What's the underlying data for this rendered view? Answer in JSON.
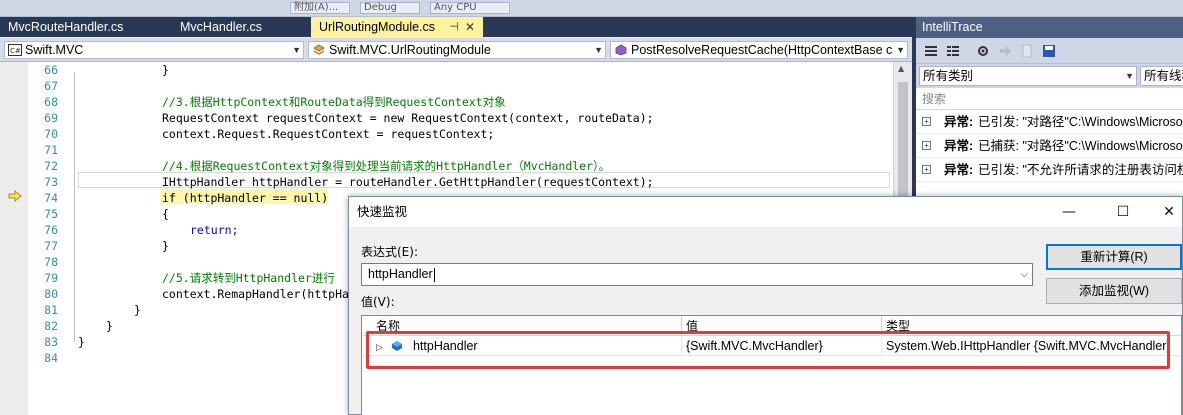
{
  "toolbar": {
    "debug_mode": "Debug",
    "platform": "Any CPU",
    "attach": "附加(A)..."
  },
  "tabs": [
    {
      "label": "MvcRouteHandler.cs"
    },
    {
      "label": "MvcHandler.cs"
    },
    {
      "label": "UrlRoutingModule.cs",
      "active": true
    }
  ],
  "navbar": {
    "project": "Swift.MVC",
    "class": "Swift.MVC.UrlRoutingModule",
    "member": "PostResolveRequestCache(HttpContextBase c"
  },
  "code": {
    "lines": [
      {
        "n": "66",
        "text": "}"
      },
      {
        "n": "67",
        "text": ""
      },
      {
        "n": "68",
        "text": "//3.根据HttpContext和RouteData得到RequestContext对象"
      },
      {
        "n": "69",
        "text": "RequestContext requestContext = new RequestContext(context, routeData);"
      },
      {
        "n": "70",
        "text": "context.Request.RequestContext = requestContext;"
      },
      {
        "n": "71",
        "text": ""
      },
      {
        "n": "72",
        "text": "//4.根据RequestContext对象得到处理当前请求的HttpHandler（MvcHandler）。"
      },
      {
        "n": "73",
        "text": "IHttpHandler httpHandler = routeHandler.GetHttpHandler(requestContext);"
      },
      {
        "n": "74",
        "text": "if (httpHandler == null)"
      },
      {
        "n": "75",
        "text": "{"
      },
      {
        "n": "76",
        "text": "return;"
      },
      {
        "n": "77",
        "text": "}"
      },
      {
        "n": "78",
        "text": ""
      },
      {
        "n": "79",
        "text": "//5.请求转到HttpHandler进行"
      },
      {
        "n": "80",
        "text": "context.RemapHandler(httpHa"
      },
      {
        "n": "81",
        "text": "}"
      },
      {
        "n": "82",
        "text": "}"
      },
      {
        "n": "83",
        "text": "}"
      },
      {
        "n": "84",
        "text": ""
      }
    ]
  },
  "intellitrace": {
    "title": "IntelliTrace",
    "category_filter": "所有类别",
    "thread_filter": "所有线程",
    "search_placeholder": "搜索",
    "events": [
      {
        "kind": "异常:",
        "desc": "已引发: \"对路径\"C:\\Windows\\Microso"
      },
      {
        "kind": "异常:",
        "desc": "已捕获: \"对路径\"C:\\Windows\\Microso"
      },
      {
        "kind": "异常:",
        "desc": "已引发: \"不允许所请求的注册表访问权"
      }
    ]
  },
  "quickwatch": {
    "title": "快速监视",
    "expression_label": "表达式(E):",
    "expression_value": "httpHandler",
    "value_label": "值(V):",
    "reevaluate_button": "重新计算(R)",
    "add_watch_button": "添加监视(W)",
    "columns": {
      "name": "名称",
      "value": "值",
      "type": "类型"
    },
    "rows": [
      {
        "name": "httpHandler",
        "value": "{Swift.MVC.MvcHandler}",
        "type": "System.Web.IHttpHandler {Swift.MVC.MvcHandler}"
      }
    ]
  },
  "colors": {
    "accent": "#0078d7",
    "highlight_box": "#e53935",
    "current_statement": "#fff5a8"
  }
}
